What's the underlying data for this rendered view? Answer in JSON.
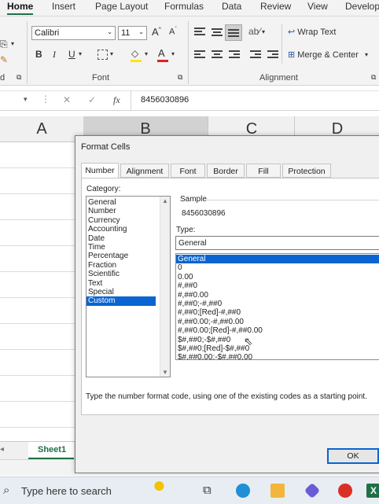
{
  "ribbon": {
    "tabs": [
      "Home",
      "Insert",
      "Page Layout",
      "Formulas",
      "Data",
      "Review",
      "View",
      "Develop"
    ],
    "font_name": "Calibri",
    "font_size": "11",
    "font_group_label": "Font",
    "alignment_group_label": "Alignment",
    "wrap_text_label": "Wrap Text",
    "merge_center_label": "Merge & Center",
    "left_group_label": "d",
    "bold": "B",
    "italic": "I",
    "underline": "U",
    "grow_font": "A",
    "shrink_font": "A",
    "font_color_glyph": "A",
    "fill_color_glyph": "◇"
  },
  "formula_bar": {
    "value": "8456030896",
    "fx": "fx",
    "cancel": "✕",
    "enter": "✓"
  },
  "grid": {
    "columns": [
      "A",
      "B",
      "C",
      "D"
    ],
    "sheet_tab": "Sheet1"
  },
  "dialog": {
    "title": "Format Cells",
    "tabs": [
      "Number",
      "Alignment",
      "Font",
      "Border",
      "Fill",
      "Protection"
    ],
    "category_label": "Category:",
    "categories": [
      "General",
      "Number",
      "Currency",
      "Accounting",
      "Date",
      "Time",
      "Percentage",
      "Fraction",
      "Scientific",
      "Text",
      "Special",
      "Custom"
    ],
    "selected_category": "Custom",
    "sample_label": "Sample",
    "sample_value": "8456030896",
    "type_label": "Type:",
    "type_value": "General",
    "type_list": [
      "General",
      "0",
      "0.00",
      "#,##0",
      "#,##0.00",
      "#,##0;-#,##0",
      "#,##0;[Red]-#,##0",
      "#,##0.00;-#,##0.00",
      "#,##0.00;[Red]-#,##0.00",
      "$#,##0;-$#,##0",
      "$#,##0;[Red]-$#,##0",
      "$#,##0.00;-$#,##0.00"
    ],
    "help_text": "Type the number format code, using one of the existing codes as a starting point.",
    "ok_label": "OK"
  },
  "taskbar": {
    "search_placeholder": "Type here to search"
  },
  "colors": {
    "selection": "#0a64d1",
    "excel_green": "#1e7145",
    "font_color_red": "#e02020",
    "fill_yellow": "#ffe500"
  }
}
